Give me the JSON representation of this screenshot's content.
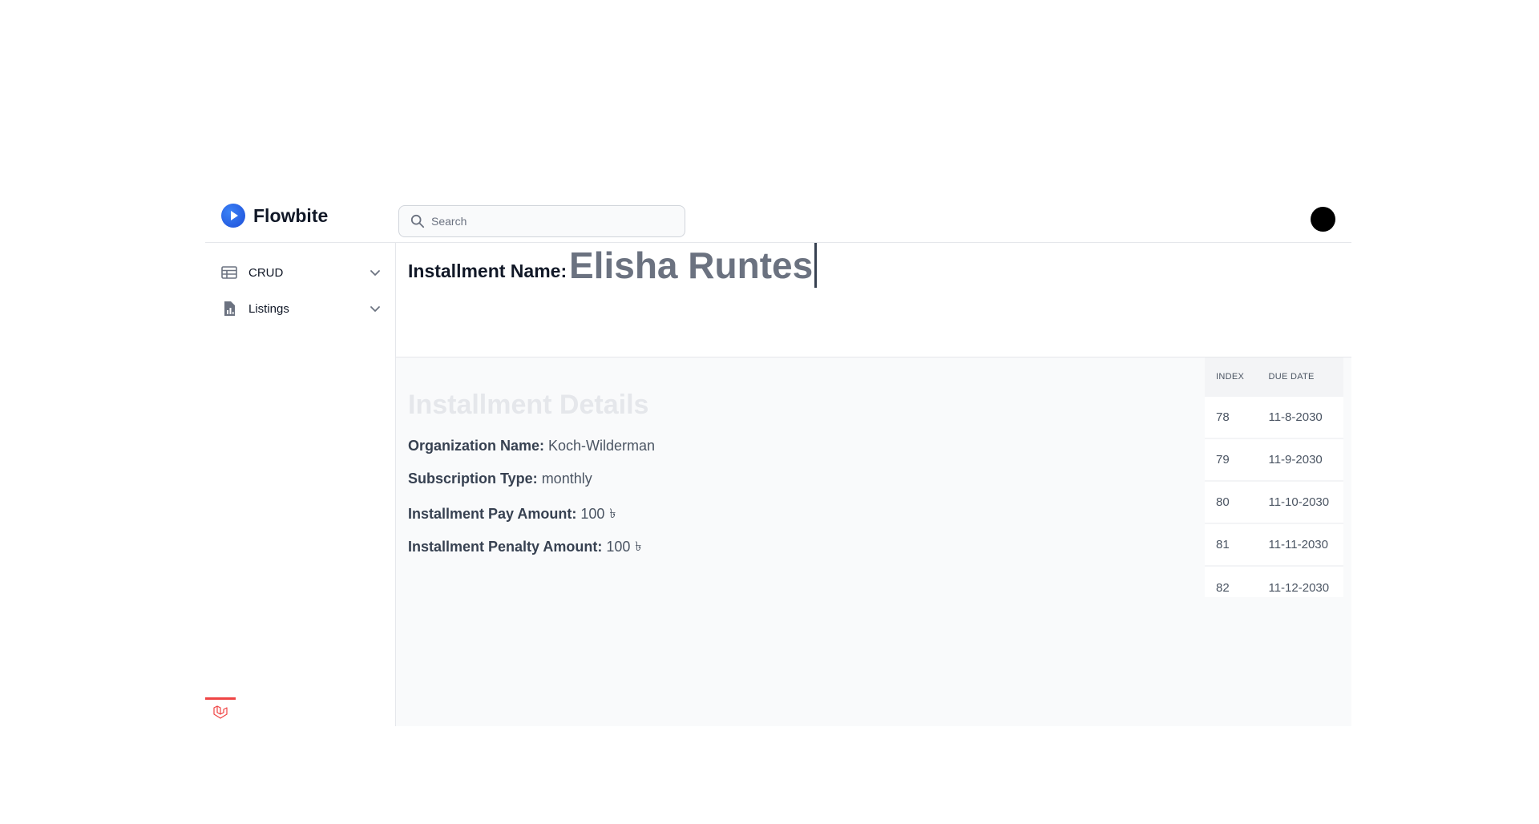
{
  "header": {
    "brand": "Flowbite",
    "search_placeholder": "Search"
  },
  "sidebar": {
    "items": [
      {
        "label": "CRUD",
        "icon": "table-icon"
      },
      {
        "label": "Listings",
        "icon": "document-chart-icon"
      }
    ]
  },
  "installment": {
    "name_label": "Installment Name:",
    "name_value": "Elisha Runtes"
  },
  "details": {
    "title": "Installment Details",
    "organization": {
      "label": "Organization Name:",
      "value": "Koch-Wilderman"
    },
    "subscription": {
      "label": "Subscription Type:",
      "value": "monthly"
    },
    "pay_amount": {
      "label": "Installment Pay Amount:",
      "value": "100",
      "currency": "৳"
    },
    "penalty_amount": {
      "label": "Installment Penalty Amount:",
      "value": "100",
      "currency": "৳"
    }
  },
  "schedule": {
    "columns": [
      "INDEX",
      "DUE DATE"
    ],
    "rows": [
      [
        "78",
        "11-8-2030"
      ],
      [
        "79",
        "11-9-2030"
      ],
      [
        "80",
        "11-10-2030"
      ],
      [
        "81",
        "11-11-2030"
      ],
      [
        "82",
        "11-12-2030"
      ]
    ]
  }
}
